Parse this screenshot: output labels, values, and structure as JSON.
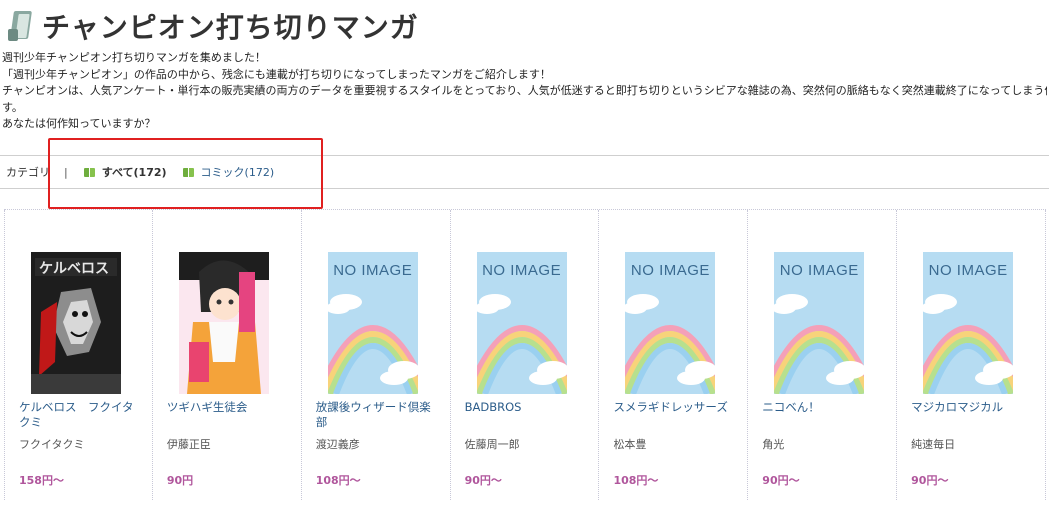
{
  "header": {
    "title": "チャンピオン打ち切りマンガ",
    "icon": "book-icon"
  },
  "intro": {
    "lines": [
      "週刊少年チャンピオン打ち切りマンガを集めました！",
      "「週刊少年チャンピオン」の作品の中から、残念にも連載が打ち切りになってしまったマンガをご紹介します！",
      "チャンピオンは、人気アンケート・単行本の販売実績の両方のデータを重要視するスタイルをとっており、人気が低迷すると即打ち切りというシビアな雑誌の為、突然何の脈絡もなく突然連載終了になってしまう作",
      "す。",
      "あなたは何作知っていますか？"
    ]
  },
  "categories": {
    "label": "カテゴリ",
    "separator": "|",
    "items": [
      {
        "label": "すべて(172)",
        "active": true
      },
      {
        "label": "コミック(172)",
        "active": false
      }
    ]
  },
  "products": [
    {
      "title": "ケルベロス　フクイタクミ",
      "author": "フクイタクミ",
      "price": "158円〜",
      "cover": "art-1"
    },
    {
      "title": "ツギハギ生徒会",
      "author": "伊藤正臣",
      "price": "90円",
      "cover": "art-2"
    },
    {
      "title": "放課後ウィザード倶楽部",
      "author": "渡辺義彦",
      "price": "108円〜",
      "cover": "NO IMAGE"
    },
    {
      "title": "BADBROS",
      "author": "佐藤周一郎",
      "price": "90円〜",
      "cover": "NO IMAGE"
    },
    {
      "title": "スメラギドレッサーズ",
      "author": "松本豊",
      "price": "108円〜",
      "cover": "NO IMAGE"
    },
    {
      "title": "ニコベん！",
      "author": "角光",
      "price": "90円〜",
      "cover": "NO IMAGE"
    },
    {
      "title": "マジカロマジカル",
      "author": "純速毎日",
      "price": "90円〜",
      "cover": "NO IMAGE"
    }
  ],
  "colors": {
    "link": "#2b5c8a",
    "price": "#b0569c",
    "highlight": "#e02020",
    "noimage_bg": "#b6dcf2"
  }
}
